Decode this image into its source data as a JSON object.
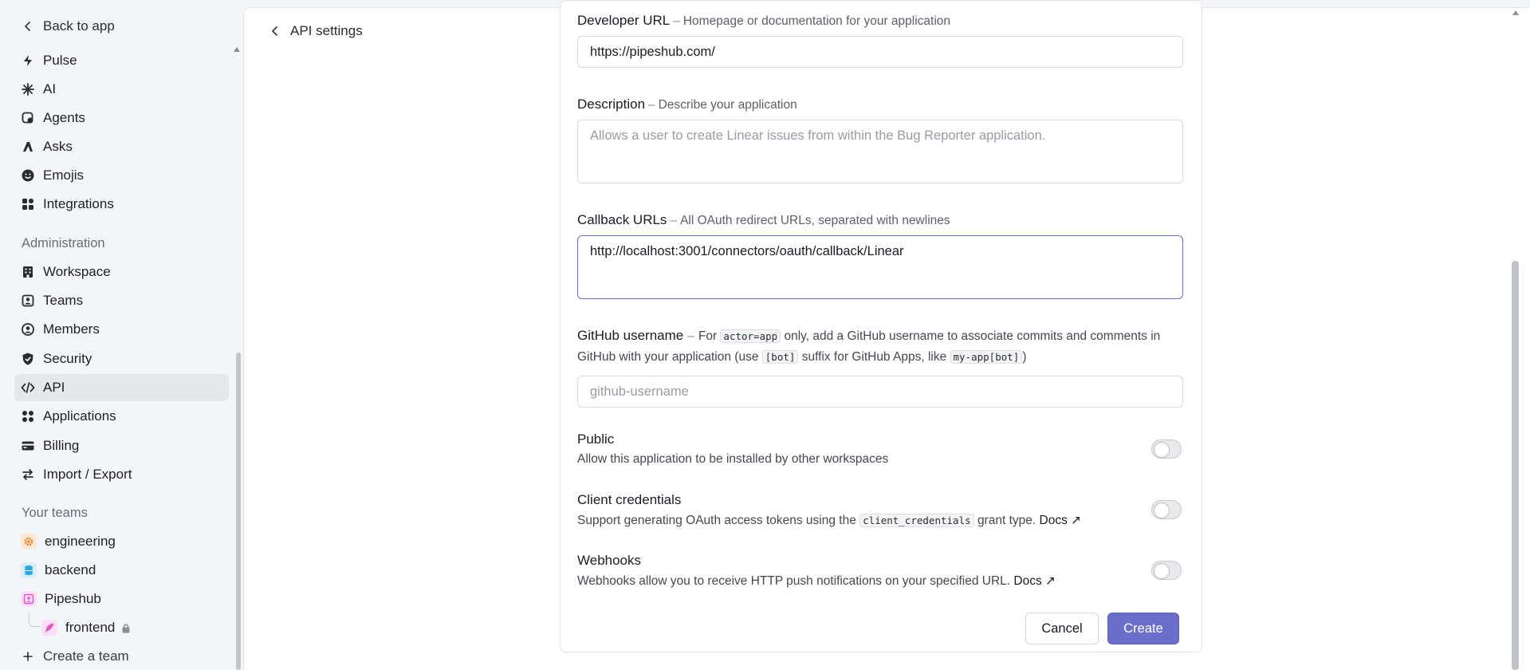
{
  "sidebar": {
    "back_label": "Back to app",
    "top_items": [
      {
        "label": "Pulse",
        "icon": "pulse-icon"
      },
      {
        "label": "AI",
        "icon": "ai-sparkle-icon"
      },
      {
        "label": "Agents",
        "icon": "agents-icon"
      },
      {
        "label": "Asks",
        "icon": "asks-icon"
      },
      {
        "label": "Emojis",
        "icon": "emoji-icon"
      },
      {
        "label": "Integrations",
        "icon": "integrations-icon"
      }
    ],
    "admin_heading": "Administration",
    "admin_items": [
      {
        "label": "Workspace",
        "icon": "building-icon"
      },
      {
        "label": "Teams",
        "icon": "teams-icon"
      },
      {
        "label": "Members",
        "icon": "members-icon"
      },
      {
        "label": "Security",
        "icon": "shield-icon"
      },
      {
        "label": "API",
        "icon": "code-icon",
        "active": true
      },
      {
        "label": "Applications",
        "icon": "applications-icon"
      },
      {
        "label": "Billing",
        "icon": "credit-card-icon"
      },
      {
        "label": "Import / Export",
        "icon": "import-export-icon"
      }
    ],
    "teams_heading": "Your teams",
    "teams": [
      {
        "label": "engineering",
        "icon": "gear-icon",
        "color": "#f07c1e"
      },
      {
        "label": "backend",
        "icon": "database-icon",
        "color": "#2ea7e0"
      },
      {
        "label": "Pipeshub",
        "icon": "contact-card-icon",
        "color": "#e255c9"
      },
      {
        "label": "frontend",
        "icon": "feather-icon",
        "color": "#e255c9",
        "locked": true
      }
    ],
    "create_team_label": "Create a team"
  },
  "main": {
    "back_label": "API settings",
    "form": {
      "developer_url": {
        "label": "Developer URL",
        "hint": "Homepage or documentation for your application",
        "value": "https://pipeshub.com/"
      },
      "description": {
        "label": "Description",
        "hint": "Describe your application",
        "placeholder": "Allows a user to create Linear issues from within the Bug Reporter application."
      },
      "callback_urls": {
        "label": "Callback URLs",
        "hint": "All OAuth redirect URLs, separated with newlines",
        "value": "http://localhost:3001/connectors/oauth/callback/Linear"
      },
      "github_username": {
        "label": "GitHub username",
        "hint_prefix": "For",
        "hint_code1": "actor=app",
        "hint_middle": "only, add a GitHub username to associate commits and comments in GitHub with your application (use",
        "hint_code2": "[bot]",
        "hint_middle2": "suffix for GitHub Apps, like",
        "hint_code3": "my-app[bot]",
        "hint_suffix": ")",
        "placeholder": "github-username"
      },
      "public": {
        "title": "Public",
        "description": "Allow this application to be installed by other workspaces",
        "enabled": false
      },
      "client_credentials": {
        "title": "Client credentials",
        "description_prefix": "Support generating OAuth access tokens using the",
        "description_code": "client_credentials",
        "description_suffix": "grant type.",
        "docs_label": "Docs ↗",
        "enabled": false
      },
      "webhooks": {
        "title": "Webhooks",
        "description": "Webhooks allow you to receive HTTP push notifications on your specified URL.",
        "docs_label": "Docs ↗",
        "enabled": false
      },
      "cancel_label": "Cancel",
      "create_label": "Create"
    },
    "accent_color": "#6b6fc9"
  }
}
